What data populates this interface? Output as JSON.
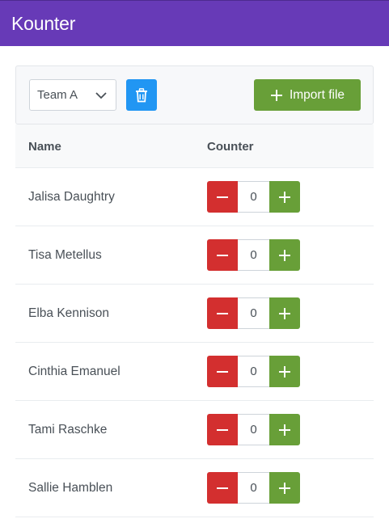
{
  "app": {
    "title": "Kounter"
  },
  "toolbar": {
    "team_select": {
      "selected": "Team A",
      "icon": "chevron-down-icon"
    },
    "delete_icon": "trash-icon",
    "import_label": "Import file",
    "import_icon": "plus-icon"
  },
  "colors": {
    "appbar": "#673ab7",
    "delete": "#2196f3",
    "import": "#689f38",
    "minus": "#d32f2f",
    "plus": "#689f38"
  },
  "table": {
    "headers": {
      "name": "Name",
      "counter": "Counter"
    },
    "rows": [
      {
        "name": "Jalisa Daughtry",
        "count": "0"
      },
      {
        "name": "Tisa Metellus",
        "count": "0"
      },
      {
        "name": "Elba Kennison",
        "count": "0"
      },
      {
        "name": "Cinthia Emanuel",
        "count": "0"
      },
      {
        "name": "Tami Raschke",
        "count": "0"
      },
      {
        "name": "Sallie Hamblen",
        "count": "0"
      }
    ]
  }
}
